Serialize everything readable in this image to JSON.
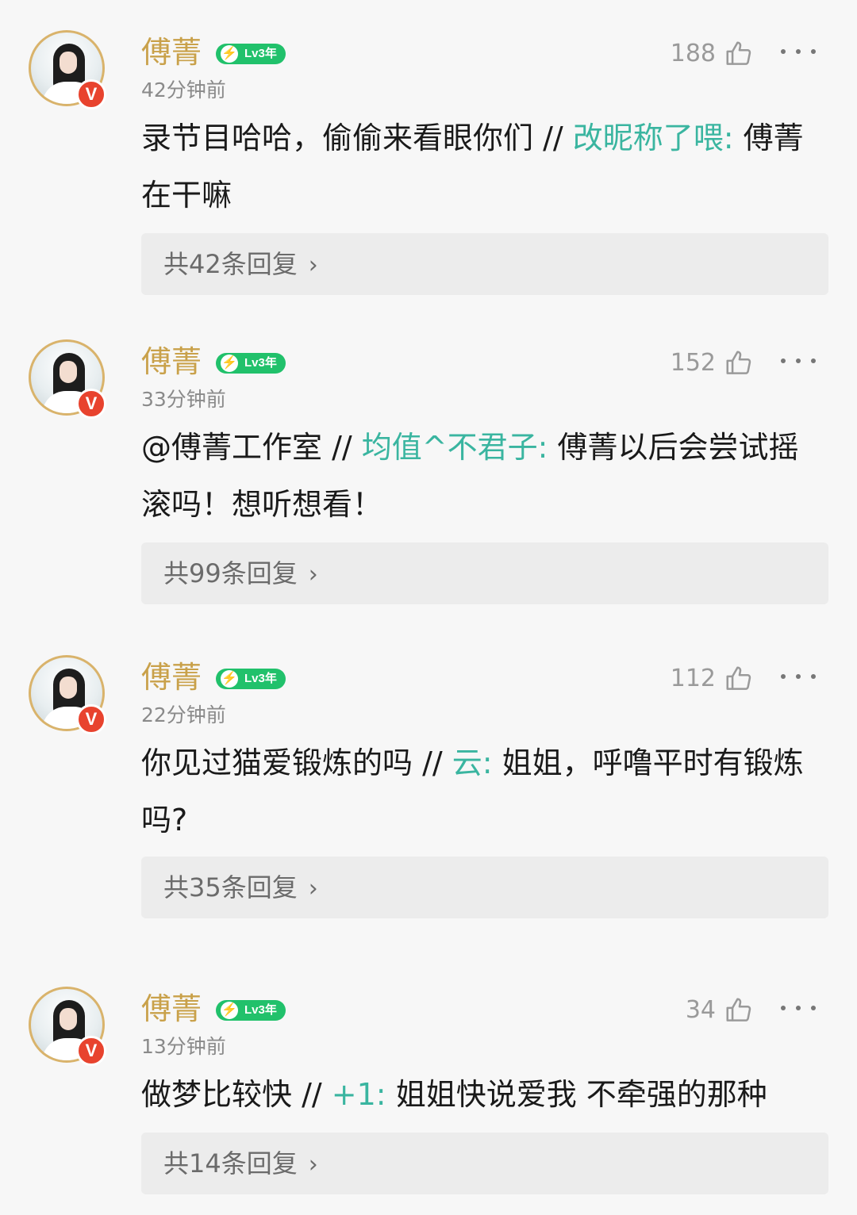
{
  "comments": [
    {
      "name": "傅菁",
      "level": "Lv3年",
      "verified_badge": "V",
      "time": "42分钟前",
      "likes": "188",
      "reply": "录节目哈哈，偷偷来看眼你们",
      "separator": " // ",
      "quoted_user": "改昵称了喂:",
      "quoted_text": " 傅菁在干嘛",
      "replies_label": "共42条回复",
      "chevron": "›"
    },
    {
      "name": "傅菁",
      "level": "Lv3年",
      "verified_badge": "V",
      "time": "33分钟前",
      "likes": "152",
      "reply": "@傅菁工作室",
      "separator": " // ",
      "quoted_user": "均值^不君子:",
      "quoted_text": " 傅菁以后会尝试摇滚吗！想听想看！",
      "replies_label": "共99条回复",
      "chevron": "›"
    },
    {
      "name": "傅菁",
      "level": "Lv3年",
      "verified_badge": "V",
      "time": "22分钟前",
      "likes": "112",
      "reply": "你见过猫爱锻炼的吗",
      "separator": " // ",
      "quoted_user": "云:",
      "quoted_text": " 姐姐，呼噜平时有锻炼吗?",
      "replies_label": "共35条回复",
      "chevron": "›"
    },
    {
      "name": "傅菁",
      "level": "Lv3年",
      "verified_badge": "V",
      "time": "13分钟前",
      "likes": "34",
      "reply": "做梦比较快",
      "separator": " // ",
      "quoted_user": "+1:",
      "quoted_text": " 姐姐快说爱我 不牵强的那种",
      "replies_label": "共14条回复",
      "chevron": "›"
    }
  ],
  "colors": {
    "name_gold": "#c9a14a",
    "mention_teal": "#3ab5a0",
    "level_green": "#21c16b",
    "verified_red": "#e8432e"
  },
  "icons": {
    "like": "thumbs-up-icon",
    "more": "more-dots-icon",
    "chevron": "chevron-right-icon",
    "level": "lightning-icon"
  }
}
